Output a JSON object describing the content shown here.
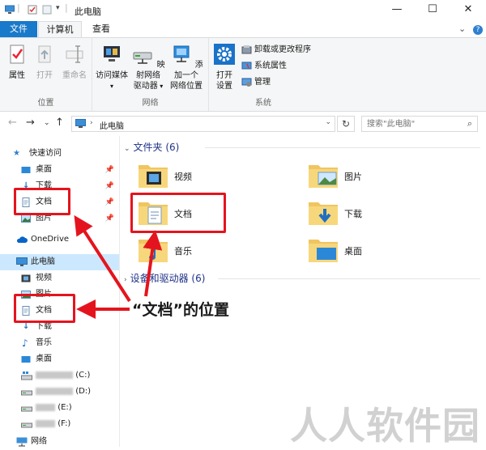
{
  "window": {
    "title": "此电脑",
    "minimize": "—",
    "maximize": "☐",
    "close": "✕"
  },
  "ribbon_tabs": {
    "file": "文件",
    "computer": "计算机",
    "view": "查看",
    "expand": "⌄",
    "help": "?"
  },
  "ribbon": {
    "location": {
      "label": "位置",
      "properties": "属性",
      "open": "打开",
      "rename": "重命名"
    },
    "network": {
      "label": "网络",
      "media_line1": "访问媒体",
      "map_line1": "映射网络",
      "map_line2": "驱动器",
      "add_line1": "添加一个",
      "add_line2": "网络位置"
    },
    "system": {
      "label": "系统",
      "open_line1": "打开",
      "open_line2": "设置",
      "uninstall": "卸载或更改程序",
      "sysprops": "系统属性",
      "manage": "管理"
    }
  },
  "address": {
    "path": "此电脑",
    "search_placeholder": "搜索\"此电脑\""
  },
  "nav": {
    "quick_access": "快速访问",
    "qa_desktop": "桌面",
    "qa_downloads": "下载",
    "qa_documents": "文档",
    "qa_pictures": "图片",
    "onedrive": "OneDrive",
    "this_pc": "此电脑",
    "pc_videos": "视频",
    "pc_pictures": "图片",
    "pc_documents": "文档",
    "pc_downloads": "下载",
    "pc_music": "音乐",
    "pc_desktop": "桌面",
    "drive_c": "(C:)",
    "drive_d": "(D:)",
    "drive_e": "(E:)",
    "drive_f": "(F:)",
    "network": "网络"
  },
  "content": {
    "folders_header": "文件夹 (6)",
    "devices_header": "设备和驱动器 (6)",
    "folders": {
      "videos": "视频",
      "pictures": "图片",
      "documents": "文档",
      "downloads": "下载",
      "music": "音乐",
      "desktop": "桌面"
    }
  },
  "annotation": "“文档”的位置",
  "watermark": "人人软件园",
  "colors": {
    "accent": "#1979ca",
    "annotation_red": "#e4141e",
    "selected": "#cce8ff",
    "section_blue": "#1e3287"
  }
}
